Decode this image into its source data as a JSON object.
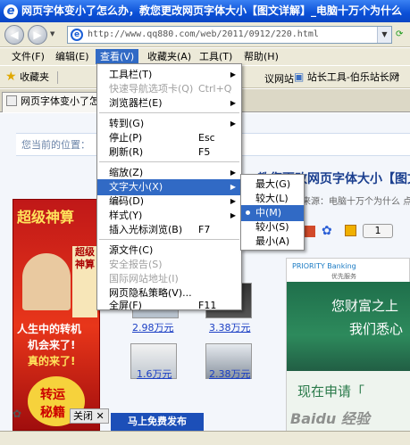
{
  "window": {
    "title": "网页字体变小了怎么办，教您更改网页字体大小【图文详解】_电脑十万个为什么"
  },
  "address": {
    "url": "http://www.qq880.com/web/2011/0912/220.html"
  },
  "menubar": [
    "文件(F)",
    "编辑(E)",
    "查看(V)",
    "收藏夹(A)",
    "工具(T)",
    "帮助(H)"
  ],
  "favorites": {
    "label": "收藏夹",
    "item1": "议网站",
    "item2": "站长工具-伯乐站长网"
  },
  "tab": {
    "label": "网页字体变小了怎"
  },
  "view_menu": [
    {
      "label": "工具栏(T)",
      "shortcut": ""
    },
    {
      "label": "快速导航选项卡(Q)",
      "shortcut": "Ctrl+Q"
    },
    {
      "label": "浏览器栏(E)",
      "shortcut": ""
    },
    {
      "label": "转到(G)",
      "shortcut": ""
    },
    {
      "label": "停止(P)",
      "shortcut": "Esc"
    },
    {
      "label": "刷新(R)",
      "shortcut": "F5"
    },
    {
      "label": "缩放(Z)",
      "shortcut": ""
    },
    {
      "label": "文字大小(X)",
      "shortcut": ""
    },
    {
      "label": "编码(D)",
      "shortcut": ""
    },
    {
      "label": "样式(Y)",
      "shortcut": ""
    },
    {
      "label": "插入光标浏览(B)",
      "shortcut": "F7"
    },
    {
      "label": "源文件(C)",
      "shortcut": ""
    },
    {
      "label": "安全报告(S)",
      "shortcut": ""
    },
    {
      "label": "国际网站地址(I)",
      "shortcut": ""
    },
    {
      "label": "网页隐私策略(V)...",
      "shortcut": ""
    },
    {
      "label": "全屏(F)",
      "shortcut": "F11"
    }
  ],
  "text_size_menu": [
    "最大(G)",
    "较大(L)",
    "中(M)",
    "较小(S)",
    "最小(A)"
  ],
  "page": {
    "location": "您当前的位置：",
    "heading": "教您更改网页字体大小【图文",
    "meta": "来源：电脑十万个为什么  点",
    "pager": "1",
    "ad_left_title": "超级神算",
    "ad_left_line1": "人生中的转机",
    "ad_left_line2": "机会来了!",
    "ad_left_line3": "真的来了!",
    "ad_left_bottom1": "转运",
    "ad_left_bottom2": "秘籍",
    "price1": "2.98万元",
    "price2": "3.38万元",
    "price3": "1.6万元",
    "price4": "2.38万元",
    "bank": "PRIORITY Banking",
    "bank_cn": "优先服务",
    "bank_line1": "您财富之上",
    "bank_line2": "我们悉心",
    "apply": "现在申请「",
    "watermark": "Baidu 经验",
    "close": "关闭",
    "publish": "马上免费发布"
  }
}
